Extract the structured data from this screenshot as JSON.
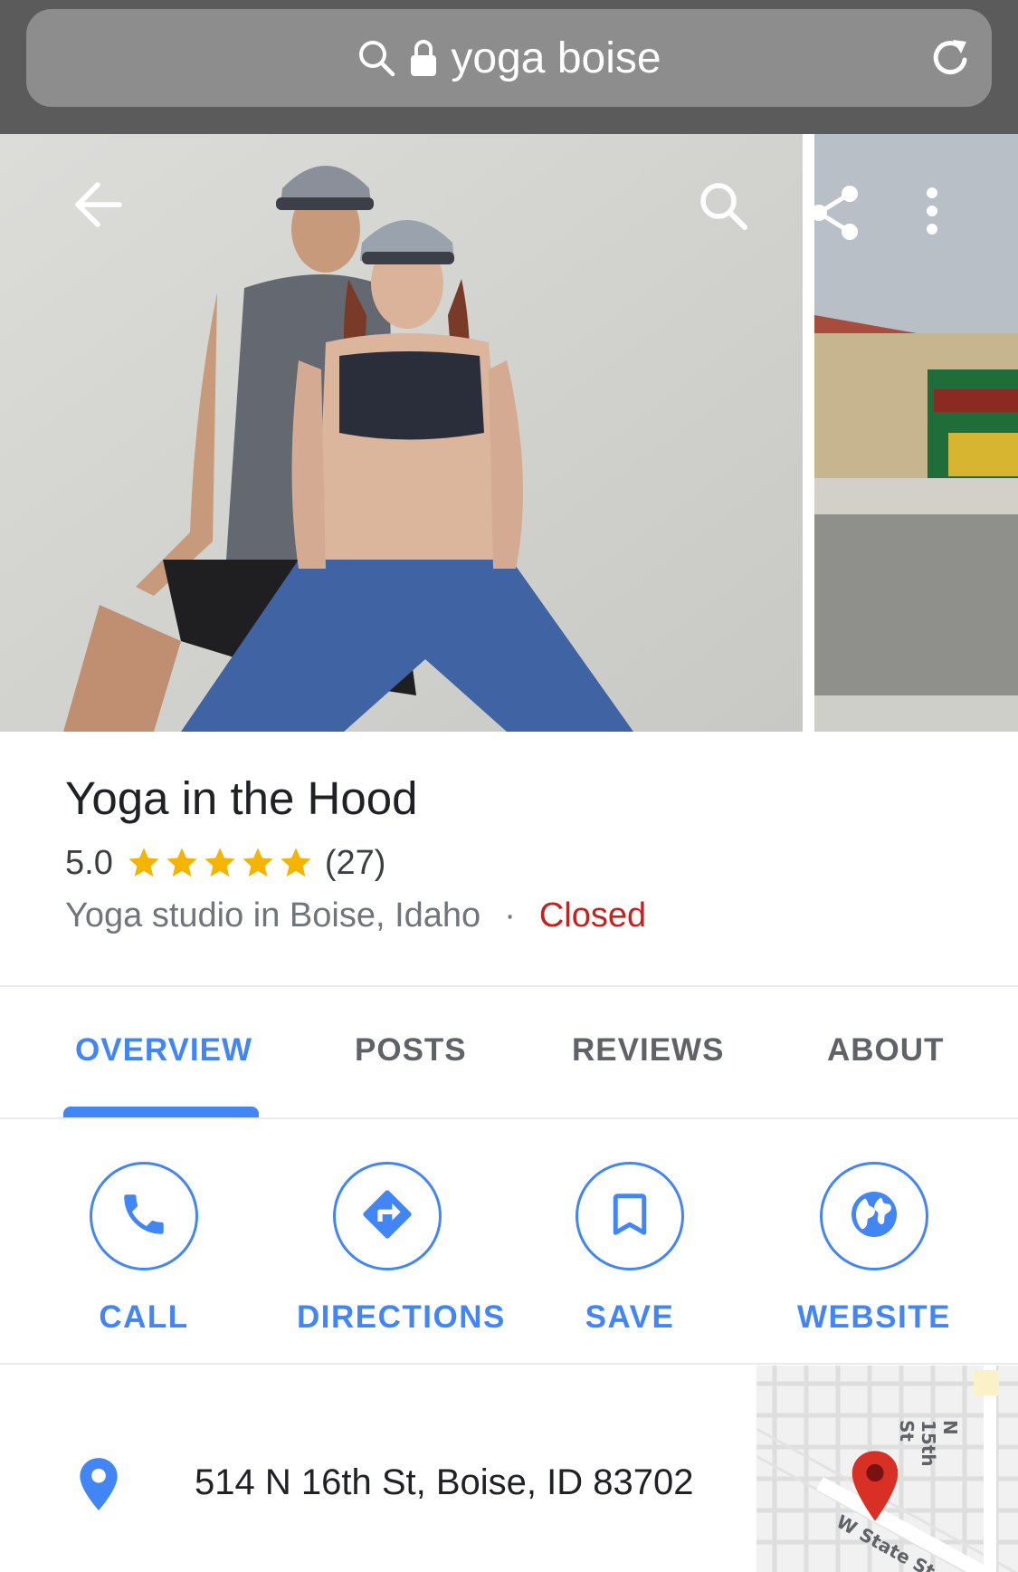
{
  "browser": {
    "search_icon": "search-icon",
    "lock_icon": "lock-icon",
    "query": "yoga boise",
    "reload_icon": "reload-icon"
  },
  "photo_overlay": {
    "back_icon": "back-arrow-icon",
    "search_icon": "search-icon",
    "share_icon": "share-icon",
    "more_icon": "more-vert-icon"
  },
  "place": {
    "title": "Yoga in the Hood",
    "rating": "5.0",
    "stars": 5,
    "review_count": "(27)",
    "category": "Yoga studio in Boise, Idaho",
    "separator": "·",
    "status": "Closed"
  },
  "tabs": [
    {
      "label": "OVERVIEW",
      "active": true
    },
    {
      "label": "POSTS",
      "active": false
    },
    {
      "label": "REVIEWS",
      "active": false
    },
    {
      "label": "ABOUT",
      "active": false
    }
  ],
  "actions": [
    {
      "label": "CALL",
      "icon": "phone-icon"
    },
    {
      "label": "DIRECTIONS",
      "icon": "directions-icon"
    },
    {
      "label": "SAVE",
      "icon": "bookmark-icon"
    },
    {
      "label": "WEBSITE",
      "icon": "globe-icon"
    }
  ],
  "address": {
    "icon": "location-pin-icon",
    "text": "514 N 16th St, Boise, ID 83702"
  },
  "map": {
    "street_1": "N 15th St",
    "street_2": "W State St"
  },
  "colors": {
    "accent": "#4285f4",
    "closed": "#c5221f",
    "star": "#f4b400"
  }
}
